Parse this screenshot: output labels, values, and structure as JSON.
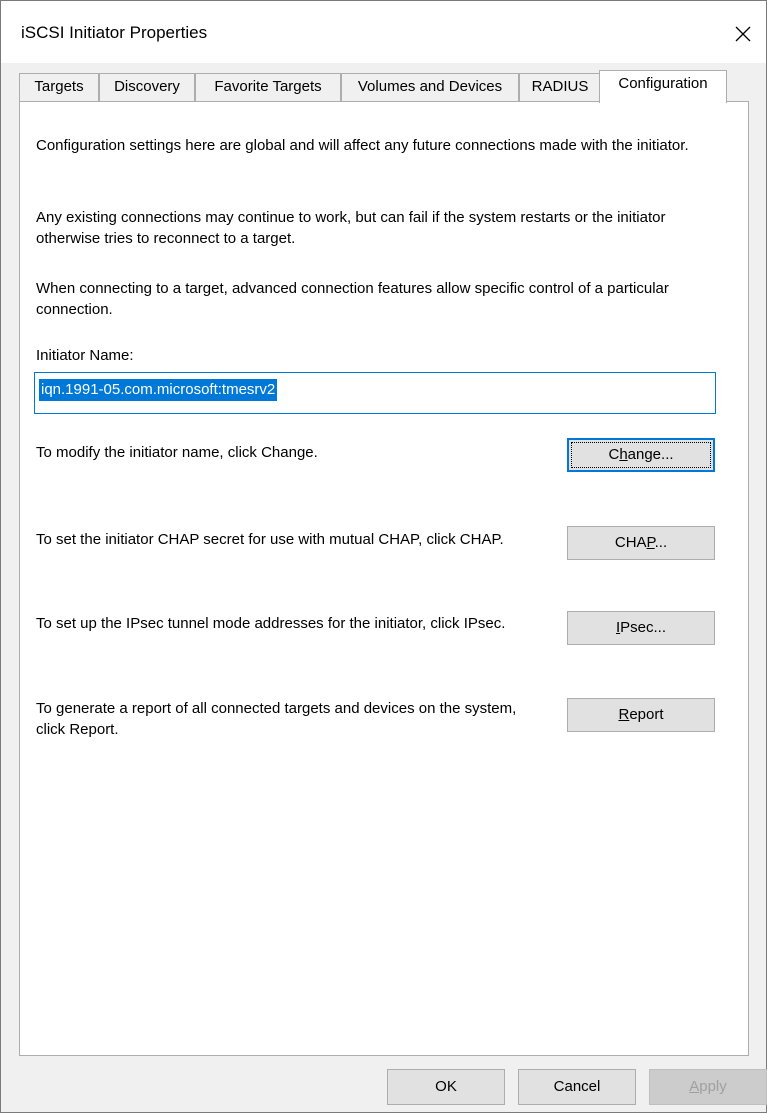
{
  "window": {
    "title": "iSCSI Initiator Properties"
  },
  "tabs": [
    {
      "label": "Targets"
    },
    {
      "label": "Discovery"
    },
    {
      "label": "Favorite Targets"
    },
    {
      "label": "Volumes and Devices"
    },
    {
      "label": "RADIUS"
    },
    {
      "label": "Configuration"
    }
  ],
  "active_tab": "Configuration",
  "config": {
    "intro1": "Configuration settings here are global and will affect any future connections made with the initiator.",
    "intro2": "Any existing connections may continue to work, but can fail if the system restarts or the initiator otherwise tries to reconnect to a target.",
    "intro3": "When connecting to a target, advanced connection features allow specific control of a particular connection.",
    "initiator_name_label": "Initiator Name:",
    "initiator_name_value": "iqn.1991-05.com.microsoft:tmesrv2",
    "change_text": "To modify the initiator name, click Change.",
    "change_button": {
      "before": "C",
      "ul": "h",
      "after": "ange..."
    },
    "chap_text": "To set the initiator CHAP secret for use with mutual CHAP, click CHAP.",
    "chap_button": {
      "before": "CHA",
      "ul": "P",
      "after": "..."
    },
    "ipsec_text": "To set up the IPsec tunnel mode addresses for the initiator, click IPsec.",
    "ipsec_button": {
      "before": "",
      "ul": "I",
      "after": "Psec..."
    },
    "report_text": "To generate a report of all connected targets and devices on the system, click Report.",
    "report_button": {
      "before": "",
      "ul": "R",
      "after": "eport"
    }
  },
  "footer": {
    "ok": "OK",
    "cancel": "Cancel",
    "apply": {
      "before": "",
      "ul": "A",
      "after": "pply"
    }
  }
}
